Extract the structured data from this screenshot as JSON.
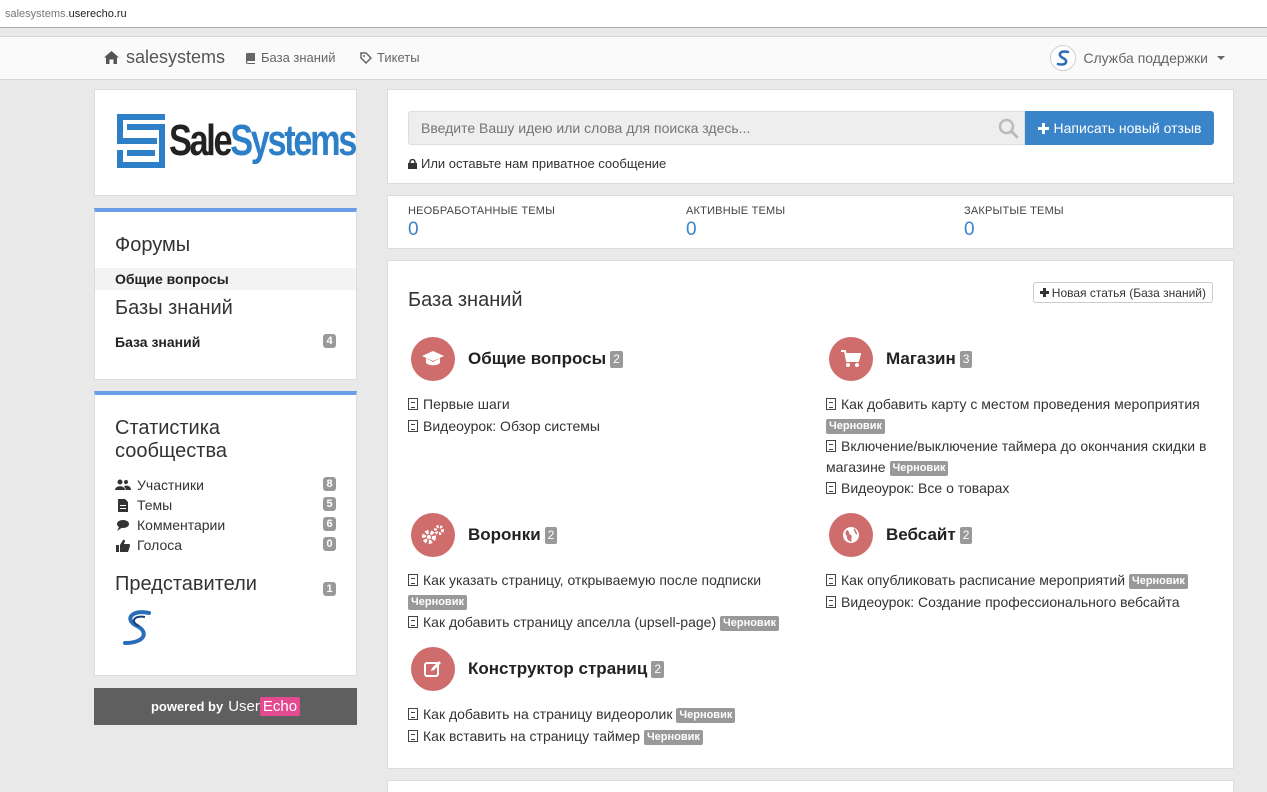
{
  "url": {
    "host_prefix": "salesystems.",
    "host_main": "userecho.ru"
  },
  "nav": {
    "brand": "salesystems",
    "kb_link": "База знаний",
    "tickets_link": "Тикеты",
    "support": "Служба поддержки"
  },
  "logo": {
    "sale": "Sale",
    "systems": "Systems"
  },
  "sidebar": {
    "forums_heading": "Форумы",
    "forum_item": "Общие вопросы",
    "kb_heading": "Базы знаний",
    "kb_item": "База знаний",
    "kb_count": "4",
    "stats_heading_1": "Статистика",
    "stats_heading_2": "сообщества",
    "stats": [
      {
        "label": "Участники",
        "count": "8"
      },
      {
        "label": "Темы",
        "count": "5"
      },
      {
        "label": "Комментарии",
        "count": "6"
      },
      {
        "label": "Голоса",
        "count": "0"
      }
    ],
    "reps_heading": "Представители",
    "reps_count": "1"
  },
  "powered": {
    "prefix": "powered by",
    "user": "User",
    "echo": "Echo"
  },
  "search": {
    "placeholder": "Введите Вашу идею или слова для поиска здесь...",
    "button": "Написать новый отзыв",
    "private": "Или оставьте нам приватное сообщение"
  },
  "counts": [
    {
      "label": "НЕОБРАБОТАННЫЕ ТЕМЫ",
      "value": "0"
    },
    {
      "label": "АКТИВНЫЕ ТЕМЫ",
      "value": "0"
    },
    {
      "label": "ЗАКРЫТЫЕ ТЕМЫ",
      "value": "0"
    }
  ],
  "kb": {
    "title": "База знаний",
    "new_article": "Новая статья (База знаний)",
    "draft_label": "Черновик",
    "categories": [
      {
        "title": "Общие вопросы",
        "count": "2",
        "articles": [
          "Первые шаги",
          "Видеоурок: Обзор системы"
        ]
      },
      {
        "title": "Магазин",
        "count": "3",
        "articles": [
          "Как добавить карту с местом проведения мероприятия",
          "Включение/выключение таймера до окончания скидки в магазине",
          "Видеоурок: Все о товарах"
        ]
      },
      {
        "title": "Воронки",
        "count": "2",
        "articles": [
          "Как указать страницу, открываемую после подписки",
          "Как добавить страницу апселла (upsell-page)"
        ]
      },
      {
        "title": "Вебсайт",
        "count": "2",
        "articles": [
          "Как опубликовать расписание мероприятий",
          "Видеоурок: Создание профессионального вебсайта"
        ]
      },
      {
        "title": "Конструктор страниц",
        "count": "2",
        "articles": [
          "Как добавить на страницу видеоролик",
          "Как вставить на страницу таймер"
        ]
      }
    ]
  }
}
